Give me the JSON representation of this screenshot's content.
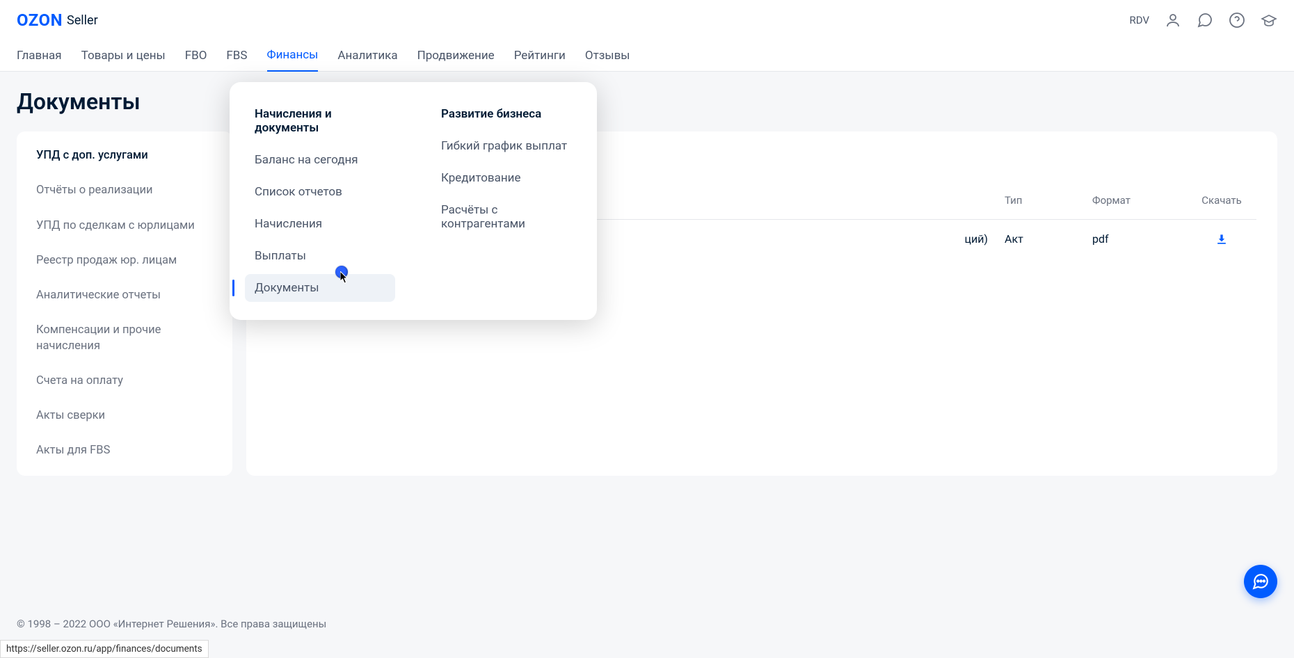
{
  "header": {
    "logo_main": "OZON",
    "logo_suffix": "Seller",
    "account": "RDV"
  },
  "nav": {
    "items": [
      {
        "label": "Главная"
      },
      {
        "label": "Товары и цены"
      },
      {
        "label": "FBO"
      },
      {
        "label": "FBS"
      },
      {
        "label": "Финансы"
      },
      {
        "label": "Аналитика"
      },
      {
        "label": "Продвижение"
      },
      {
        "label": "Рейтинги"
      },
      {
        "label": "Отзывы"
      }
    ],
    "active_index": 4
  },
  "page": {
    "title": "Документы"
  },
  "sidebar": {
    "items": [
      {
        "label": "УПД с доп. услугами"
      },
      {
        "label": "Отчёты о реализации"
      },
      {
        "label": "УПД по сделкам с юрлицами"
      },
      {
        "label": "Реестр продаж юр. лицам"
      },
      {
        "label": "Аналитические отчеты"
      },
      {
        "label": "Компенсации и прочие начисления"
      },
      {
        "label": "Счета на оплату"
      },
      {
        "label": "Акты сверки"
      },
      {
        "label": "Акты для FBS"
      }
    ],
    "active_index": 0
  },
  "table": {
    "headers": {
      "type": "Тип",
      "format": "Формат",
      "download": "Скачать"
    },
    "rows": [
      {
        "name_suffix": "ций)",
        "type": "Акт",
        "format": "pdf"
      }
    ]
  },
  "dropdown": {
    "col1": {
      "title": "Начисления и документы",
      "items": [
        {
          "label": "Баланс на сегодня"
        },
        {
          "label": "Список отчетов"
        },
        {
          "label": "Начисления"
        },
        {
          "label": "Выплаты"
        },
        {
          "label": "Документы",
          "highlighted": true
        }
      ]
    },
    "col2": {
      "title": "Развитие бизнеса",
      "items": [
        {
          "label": "Гибкий график выплат"
        },
        {
          "label": "Кредитование"
        },
        {
          "label": "Расчёты с контрагентами"
        }
      ]
    }
  },
  "footer": {
    "text": "© 1998 – 2022 ООО «Интернет Решения». Все права защищены"
  },
  "status_url": "https://seller.ozon.ru/app/finances/documents"
}
